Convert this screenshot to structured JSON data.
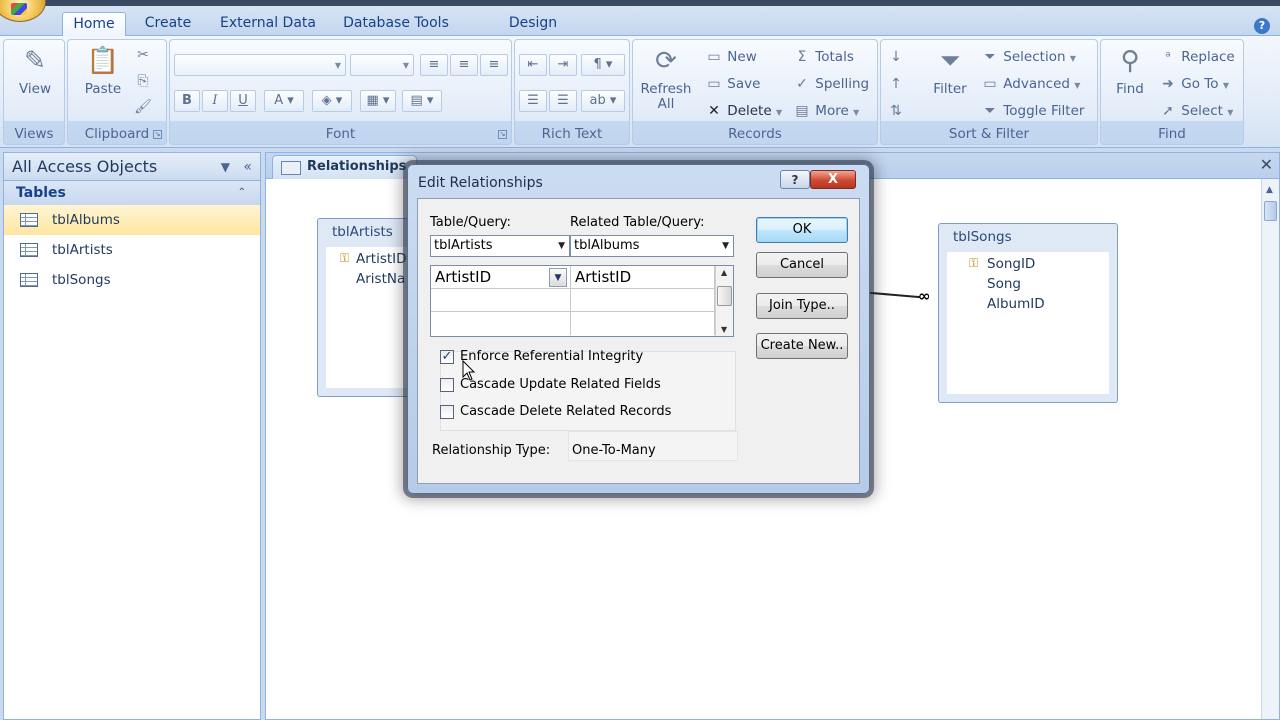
{
  "ribbon": {
    "tabs": [
      "Home",
      "Create",
      "External Data",
      "Database Tools",
      "Design"
    ],
    "active_tab": "Home",
    "groups": {
      "views": {
        "label": "Views",
        "view": "View"
      },
      "clipboard": {
        "label": "Clipboard",
        "paste": "Paste"
      },
      "font": {
        "label": "Font",
        "bold": "B",
        "italic": "I",
        "underline": "U"
      },
      "rich_text": {
        "label": "Rich Text"
      },
      "records": {
        "label": "Records",
        "refresh_line1": "Refresh",
        "refresh_line2": "All",
        "new": "New",
        "save": "Save",
        "delete": "Delete",
        "totals": "Totals",
        "spelling": "Spelling",
        "more": "More"
      },
      "sort_filter": {
        "label": "Sort & Filter",
        "filter": "Filter",
        "selection": "Selection",
        "advanced": "Advanced",
        "toggle_filter": "Toggle Filter"
      },
      "find": {
        "label": "Find",
        "find": "Find",
        "replace": "Replace",
        "go_to": "Go To",
        "select": "Select"
      }
    }
  },
  "nav": {
    "header": "All Access Objects",
    "group": "Tables",
    "items": [
      {
        "label": "tblAlbums",
        "selected": true
      },
      {
        "label": "tblArtists",
        "selected": false
      },
      {
        "label": "tblSongs",
        "selected": false
      }
    ]
  },
  "document": {
    "tab_label": "Relationships",
    "tables": {
      "artists": {
        "title": "tblArtists",
        "fields": [
          "ArtistID",
          "AristNa"
        ]
      },
      "songs": {
        "title": "tblSongs",
        "fields": [
          "SongID",
          "Song",
          "AlbumID"
        ]
      }
    },
    "many_symbol": "∞"
  },
  "dialog": {
    "title": "Edit Relationships",
    "help": "?",
    "close": "X",
    "table_query_label": "Table/Query:",
    "related_table_query_label": "Related Table/Query:",
    "table_query_value": "tblArtists",
    "related_table_query_value": "tblAlbums",
    "grid": {
      "left_field": "ArtistID",
      "right_field": "ArtistID"
    },
    "checkboxes": {
      "enforce": {
        "label": "Enforce Referential Integrity",
        "checked": true
      },
      "cascade_update": {
        "label": "Cascade Update Related Fields",
        "checked": false
      },
      "cascade_delete": {
        "label": "Cascade Delete Related Records",
        "checked": false
      }
    },
    "relationship_type_label": "Relationship Type:",
    "relationship_type_value": "One-To-Many",
    "buttons": {
      "ok": "OK",
      "cancel": "Cancel",
      "join_type": "Join Type..",
      "create_new": "Create New.."
    }
  }
}
